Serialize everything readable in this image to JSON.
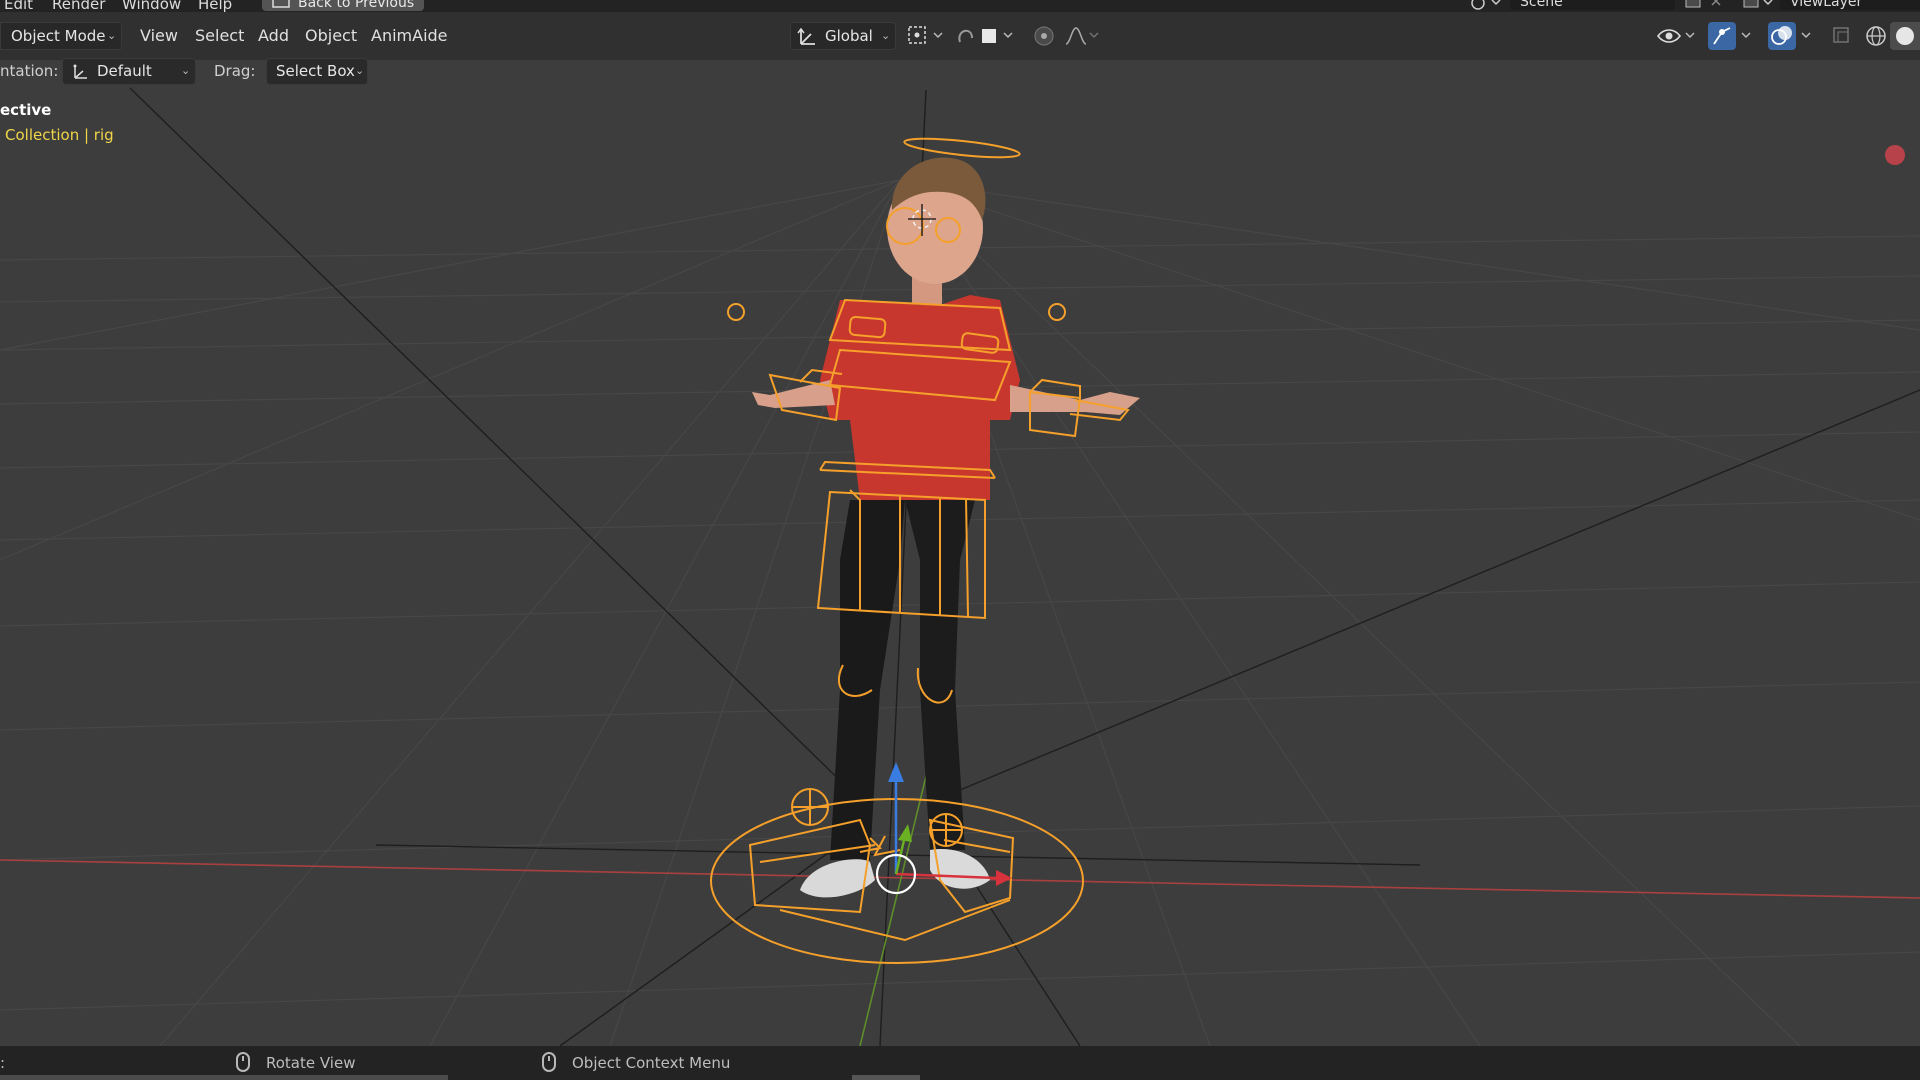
{
  "topbar": {
    "menu": [
      "Edit",
      "Render",
      "Window",
      "Help"
    ],
    "back_button": "Back to Previous",
    "scene_name": "Scene",
    "view_layer": "ViewLayer"
  },
  "header": {
    "mode": "Object Mode",
    "menus": [
      "View",
      "Select",
      "Add",
      "Object",
      "AnimAide"
    ],
    "transform_orientation": "Global"
  },
  "tool_settings": {
    "orientation_label": "ntation:",
    "orientation_value": "Default",
    "drag_label": "Drag:",
    "drag_value": "Select Box"
  },
  "overlay": {
    "view_name": "ective",
    "collection_info": "Collection | rig"
  },
  "statusbar": {
    "left_glyph": ":",
    "rotate_view": "Rotate View",
    "context_menu": "Object Context Menu"
  },
  "colors": {
    "selection_orange": "#f5a02b",
    "x_axis": "#b8403f",
    "y_axis": "#6a9a2a",
    "z_axis": "#3a7de0",
    "grid": "#4a4a4a",
    "background": "#3d3d3d"
  },
  "icons": [
    "transform-orientation-icon",
    "pivot-icon",
    "snap-icon",
    "proportional-edit-icon",
    "falloff-icon",
    "visibility-icon",
    "gizmo-icon",
    "overlay-icon",
    "xray-icon",
    "wireframe-shading-icon",
    "solid-shading-icon",
    "mouse-icon",
    "record-dot-icon"
  ]
}
